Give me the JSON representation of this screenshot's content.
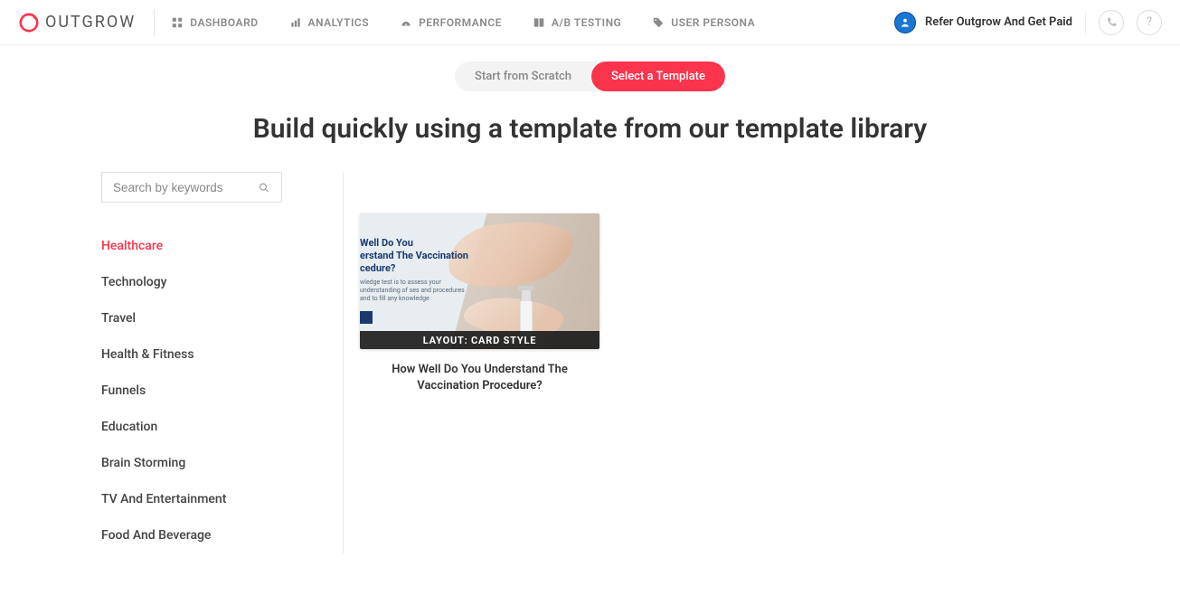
{
  "logo_text": "OUTGROW",
  "nav": [
    {
      "label": "DASHBOARD"
    },
    {
      "label": "ANALYTICS"
    },
    {
      "label": "PERFORMANCE"
    },
    {
      "label": "A/B TESTING"
    },
    {
      "label": "USER PERSONA"
    }
  ],
  "refer_label": "Refer Outgrow And Get Paid",
  "help_glyph": "?",
  "tabs": {
    "scratch": "Start from Scratch",
    "template": "Select a Template"
  },
  "page_title": "Build quickly using a template from our template library",
  "search_placeholder": "Search by keywords",
  "categories": [
    "Healthcare",
    "Technology",
    "Travel",
    "Health & Fitness",
    "Funnels",
    "Education",
    "Brain Storming",
    "TV And Entertainment",
    "Food And Beverage"
  ],
  "active_category_index": 0,
  "card": {
    "layout_label": "LAYOUT: CARD STYLE",
    "title": "How Well Do You Understand The Vaccination Procedure?",
    "thumb_heading_l1": "Well Do You",
    "thumb_heading_l2": "erstand The Vaccination",
    "thumb_heading_l3": "cedure?",
    "thumb_sub": "wledge test is to assess your understanding of ses and procedures and to fill any knowledge"
  },
  "colors": {
    "accent": "#fb344d",
    "nav_text": "#8a8a8a"
  }
}
